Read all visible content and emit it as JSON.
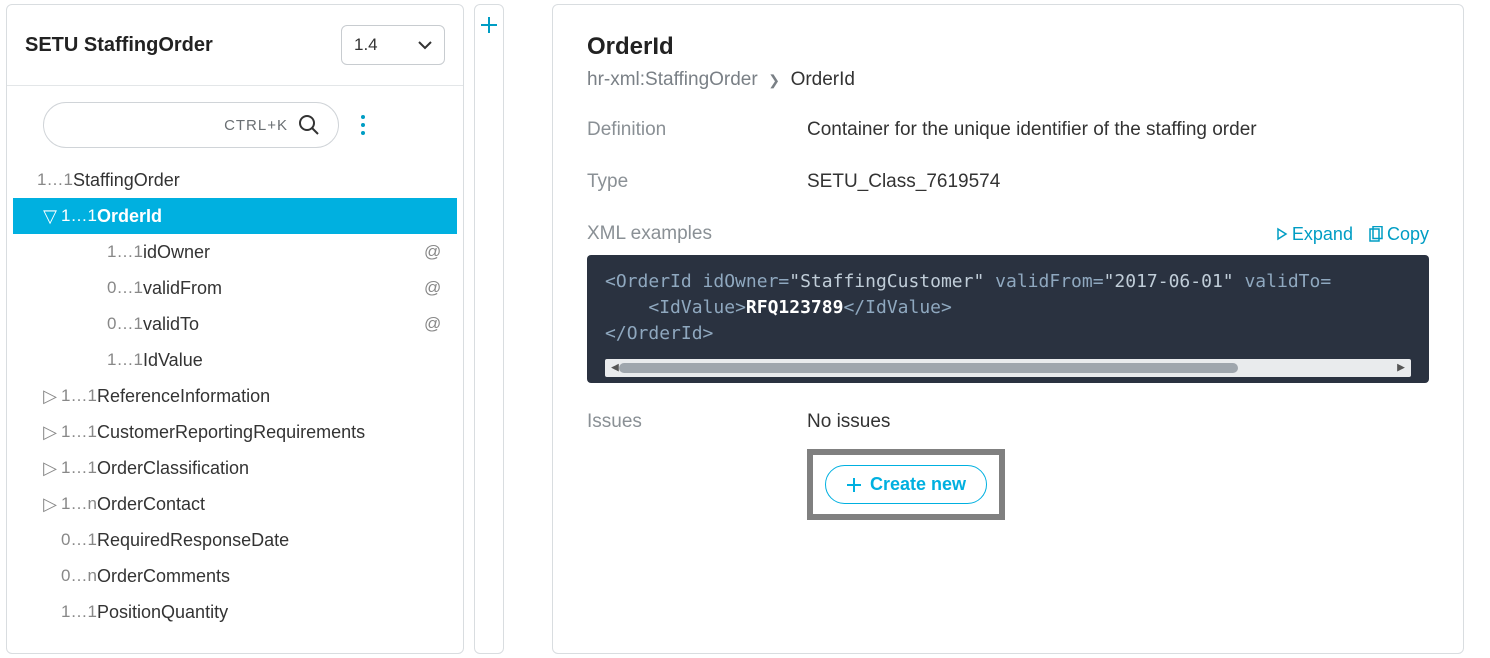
{
  "sidebar": {
    "title": "SETU StaffingOrder",
    "version": "1.4",
    "shortcut": "CTRL+K",
    "tree": [
      {
        "caret": "",
        "indent": 0,
        "card": "1…1",
        "name": "StaffingOrder",
        "attr": ""
      },
      {
        "caret": "▽",
        "indent": 1,
        "card": "1…1",
        "name": "OrderId",
        "attr": "",
        "selected": true
      },
      {
        "caret": "",
        "indent": 2,
        "card": "1…1",
        "name": "idOwner",
        "attr": "@"
      },
      {
        "caret": "",
        "indent": 2,
        "card": "0…1",
        "name": "validFrom",
        "attr": "@"
      },
      {
        "caret": "",
        "indent": 2,
        "card": "0…1",
        "name": "validTo",
        "attr": "@"
      },
      {
        "caret": "",
        "indent": 2,
        "card": "1…1",
        "name": "IdValue",
        "attr": ""
      },
      {
        "caret": "▷",
        "indent": 1,
        "card": "1…1",
        "name": "ReferenceInformation",
        "attr": ""
      },
      {
        "caret": "▷",
        "indent": 1,
        "card": "1…1",
        "name": "CustomerReportingRequirements",
        "attr": ""
      },
      {
        "caret": "▷",
        "indent": 1,
        "card": "1…1",
        "name": "OrderClassification",
        "attr": ""
      },
      {
        "caret": "▷",
        "indent": 1,
        "card": "1…n",
        "name": "OrderContact",
        "attr": ""
      },
      {
        "caret": "",
        "indent": 1,
        "card": "0…1",
        "name": "RequiredResponseDate",
        "attr": ""
      },
      {
        "caret": "",
        "indent": 1,
        "card": "0…n",
        "name": "OrderComments",
        "attr": ""
      },
      {
        "caret": "",
        "indent": 1,
        "card": "1…1",
        "name": "PositionQuantity",
        "attr": ""
      }
    ]
  },
  "main": {
    "title": "OrderId",
    "crumb_root": "hr-xml:StaffingOrder",
    "crumb_sep": "❯",
    "crumb_current": "OrderId",
    "def_label": "Definition",
    "def_value": "Container for the unique identifier of the staffing order",
    "type_label": "Type",
    "type_value": "SETU_Class_7619574",
    "xml_label": "XML examples",
    "expand": "Expand",
    "copy": "Copy",
    "code": {
      "open_tag": "OrderId",
      "a1n": "idOwner",
      "a1v": "StaffingCustomer",
      "a2n": "validFrom",
      "a2v": "2017-06-01",
      "a3n": "validTo",
      "child_tag": "IdValue",
      "child_val": "RFQ123789",
      "close_tag": "OrderId"
    },
    "issues_label": "Issues",
    "issues_value": "No issues",
    "create_btn": "Create new"
  }
}
